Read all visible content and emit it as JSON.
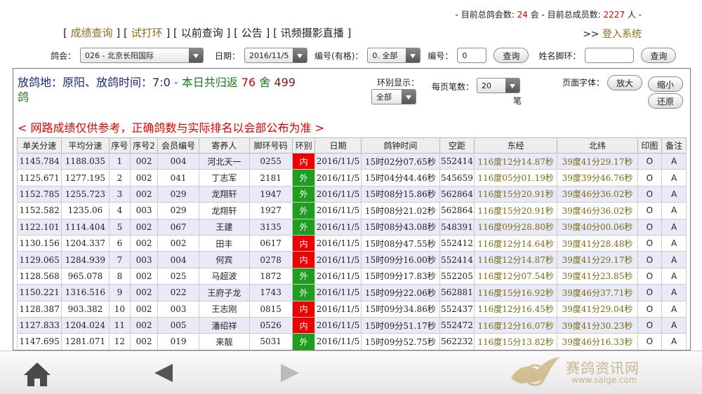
{
  "stats": {
    "prefix": "- 目前总鸽会数: ",
    "clubs": "24",
    "mid": " 会 - 目前总成员数: ",
    "members": "2227",
    "suffix": " 人 -"
  },
  "nav": {
    "links": [
      "成绩查询",
      "试打环",
      "以前查询",
      "公告",
      "讯频摄影直播"
    ],
    "login_prefix": ">> ",
    "login": "登入系统"
  },
  "filters": {
    "club_label": "鸽会：",
    "club_value": "026 - 北京长阳国际",
    "date_label": "日期：",
    "date_value": "2016/11/5",
    "code_label": "编号(有格)：",
    "code_value": "0. 全部",
    "num_label": "编号：",
    "num_value": "0",
    "query1": "查询",
    "name_label": "姓名脚环：",
    "name_value": "",
    "query2": "查询"
  },
  "race": {
    "loc_label": "放鸽地：",
    "loc": "原阳",
    "time_label": "、放鸽时间：",
    "time": "7:0",
    "returned_label": " - 本日共归返 ",
    "returned": "76",
    "she": " 舍 ",
    "count": "499",
    "unit": "鸽"
  },
  "controls": {
    "ring_label": "环别显示：",
    "ring_value": "全部",
    "per_label": "每页笔数：",
    "per_value": "20",
    "per_unit": "笔",
    "font_label": "页面字体：",
    "zoom_in": "放大",
    "zoom_out": "缩小",
    "reset": "还原"
  },
  "notice": "< 网路成绩仅供参考，正确鸽数与实际排名以会部公布为准 >",
  "table": {
    "headers": [
      "单关分速",
      "平均分速",
      "序号",
      "序号2",
      "会员编号",
      "寄养人",
      "脚环号码",
      "环别",
      "日期",
      "鸽钟时间",
      "空距",
      "东经",
      "北纬",
      "印图",
      "备注"
    ],
    "rows": [
      [
        "1145.784",
        "1188.035",
        "1",
        "002",
        "004",
        "河北天一",
        "0255",
        "内",
        "2016/11/5",
        "15时02分07.65秒",
        "552414",
        "116度12分14.87秒",
        "39度41分29.17秒",
        "O",
        "A"
      ],
      [
        "1125.671",
        "1277.195",
        "2",
        "002",
        "041",
        "丁志军",
        "2181",
        "外",
        "2016/11/5",
        "15时04分44.46秒",
        "545659",
        "116度05分01.19秒",
        "39度39分46.76秒",
        "O",
        "A"
      ],
      [
        "1152.785",
        "1255.723",
        "3",
        "002",
        "029",
        "龙翔轩",
        "1947",
        "外",
        "2016/11/5",
        "15时08分15.86秒",
        "562864",
        "116度15分20.91秒",
        "39度46分36.02秒",
        "O",
        "A"
      ],
      [
        "1152.582",
        "1235.06",
        "4",
        "003",
        "029",
        "龙翔轩",
        "1927",
        "外",
        "2016/11/5",
        "15时08分21.02秒",
        "562864",
        "116度15分20.91秒",
        "39度46分36.02秒",
        "O",
        "A"
      ],
      [
        "1122.101",
        "1114.404",
        "5",
        "002",
        "067",
        "王建",
        "3135",
        "外",
        "2016/11/5",
        "15时08分43.08秒",
        "548391",
        "116度09分28.80秒",
        "39度40分00.06秒",
        "O",
        "A"
      ],
      [
        "1130.156",
        "1204.337",
        "6",
        "002",
        "002",
        "田丰",
        "0617",
        "内",
        "2016/11/5",
        "15时08分47.55秒",
        "552412",
        "116度12分14.64秒",
        "39度41分28.48秒",
        "O",
        "A"
      ],
      [
        "1129.065",
        "1284.939",
        "7",
        "003",
        "004",
        "何宾",
        "0278",
        "内",
        "2016/11/5",
        "15时09分16.00秒",
        "552414",
        "116度12分14.87秒",
        "39度41分29.17秒",
        "O",
        "A"
      ],
      [
        "1128.568",
        "965.078",
        "8",
        "002",
        "025",
        "马超波",
        "1872",
        "外",
        "2016/11/5",
        "15时09分17.83秒",
        "552205",
        "116度12分07.54秒",
        "39度41分23.85秒",
        "O",
        "A"
      ],
      [
        "1150.221",
        "1316.516",
        "9",
        "002",
        "022",
        "王府子龙",
        "1743",
        "外",
        "2016/11/5",
        "15时09分22.06秒",
        "562881",
        "116度15分16.92秒",
        "39度46分37.71秒",
        "O",
        "A"
      ],
      [
        "1128.387",
        "903.382",
        "10",
        "002",
        "003",
        "王志刚",
        "0815",
        "内",
        "2016/11/5",
        "15时09分34.86秒",
        "552437",
        "116度12分16.45秒",
        "39度41分29.04秒",
        "O",
        "A"
      ],
      [
        "1127.833",
        "1204.024",
        "11",
        "002",
        "005",
        "潘绍祥",
        "0526",
        "内",
        "2016/11/5",
        "15时09分51.17秒",
        "552472",
        "116度12分16.07秒",
        "39度41分30.23秒",
        "O",
        "A"
      ],
      [
        "1147.695",
        "1281.071",
        "12",
        "002",
        "019",
        "来靓",
        "5031",
        "外",
        "2016/11/5",
        "15时09分52.75秒",
        "562232",
        "116度15分13.82秒",
        "39度46分16.33秒",
        "O",
        "A"
      ]
    ]
  },
  "bottombar": {
    "icons": [
      "home-icon",
      "back-arrow-icon",
      "forward-arrow-icon"
    ],
    "watermark_cn": "赛鸽资讯网",
    "watermark_url": "www.saige.com"
  },
  "colors": {
    "ring_in": "#e00000",
    "ring_out": "#1e9e1e",
    "link": "#8a6d1c",
    "highlight_red": "#dd0000"
  }
}
